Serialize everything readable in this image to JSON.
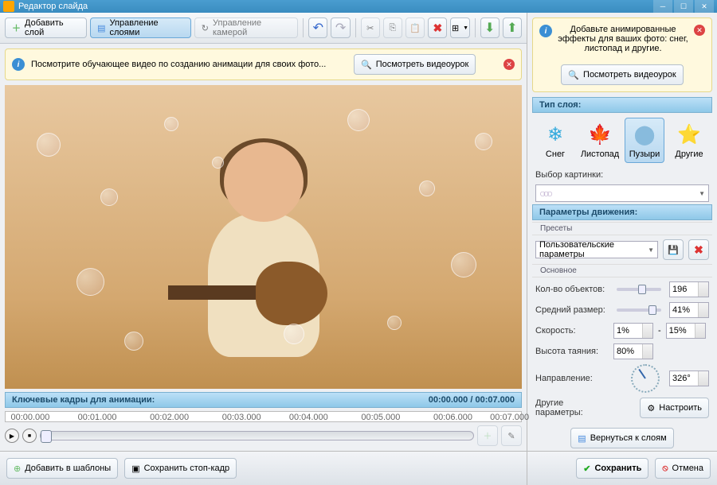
{
  "titlebar": {
    "title": "Редактор слайда"
  },
  "toolbar": {
    "add_layer": "Добавить слой",
    "manage_layers": "Управление слоями",
    "manage_camera": "Управление камерой"
  },
  "hint_left": {
    "text": "Посмотрите обучающее видео по созданию анимации для своих фото...",
    "button": "Посмотреть видеоурок"
  },
  "hint_right": {
    "text": "Добавьте анимированные эффекты для ваших фото: снег, листопад и другие.",
    "button": "Посмотреть видеоурок"
  },
  "timeline": {
    "header": "Ключевые кадры для анимации:",
    "current": "00:00.000",
    "total": "00:07.000",
    "marks": [
      "00:00.000",
      "00:01.000",
      "00:02.000",
      "00:03.000",
      "00:04.000",
      "00:05.000",
      "00:06.000",
      "00:07.000"
    ]
  },
  "footer": {
    "add_template": "Добавить в шаблоны",
    "save_frame": "Сохранить стоп-кадр",
    "save": "Сохранить",
    "cancel": "Отмена"
  },
  "panel": {
    "layer_type_hdr": "Тип слоя:",
    "types": {
      "snow": "Снег",
      "leaves": "Листопад",
      "bubbles": "Пузыри",
      "other": "Другие"
    },
    "pick_image": "Выбор картинки:",
    "motion_hdr": "Параметры движения:",
    "presets_lbl": "Пресеты",
    "preset_value": "Пользовательские параметры",
    "main_lbl": "Основное",
    "count_lbl": "Кол-во объектов:",
    "count_val": "196",
    "size_lbl": "Средний размер:",
    "size_val": "41%",
    "speed_lbl": "Скорость:",
    "speed_from": "1%",
    "speed_to": "15%",
    "speed_dash": "-",
    "melt_lbl": "Высота таяния:",
    "melt_val": "80%",
    "dir_lbl": "Направление:",
    "dir_val": "326°",
    "other_params": "Другие параметры:",
    "configure": "Настроить",
    "back": "Вернуться к слоям"
  }
}
